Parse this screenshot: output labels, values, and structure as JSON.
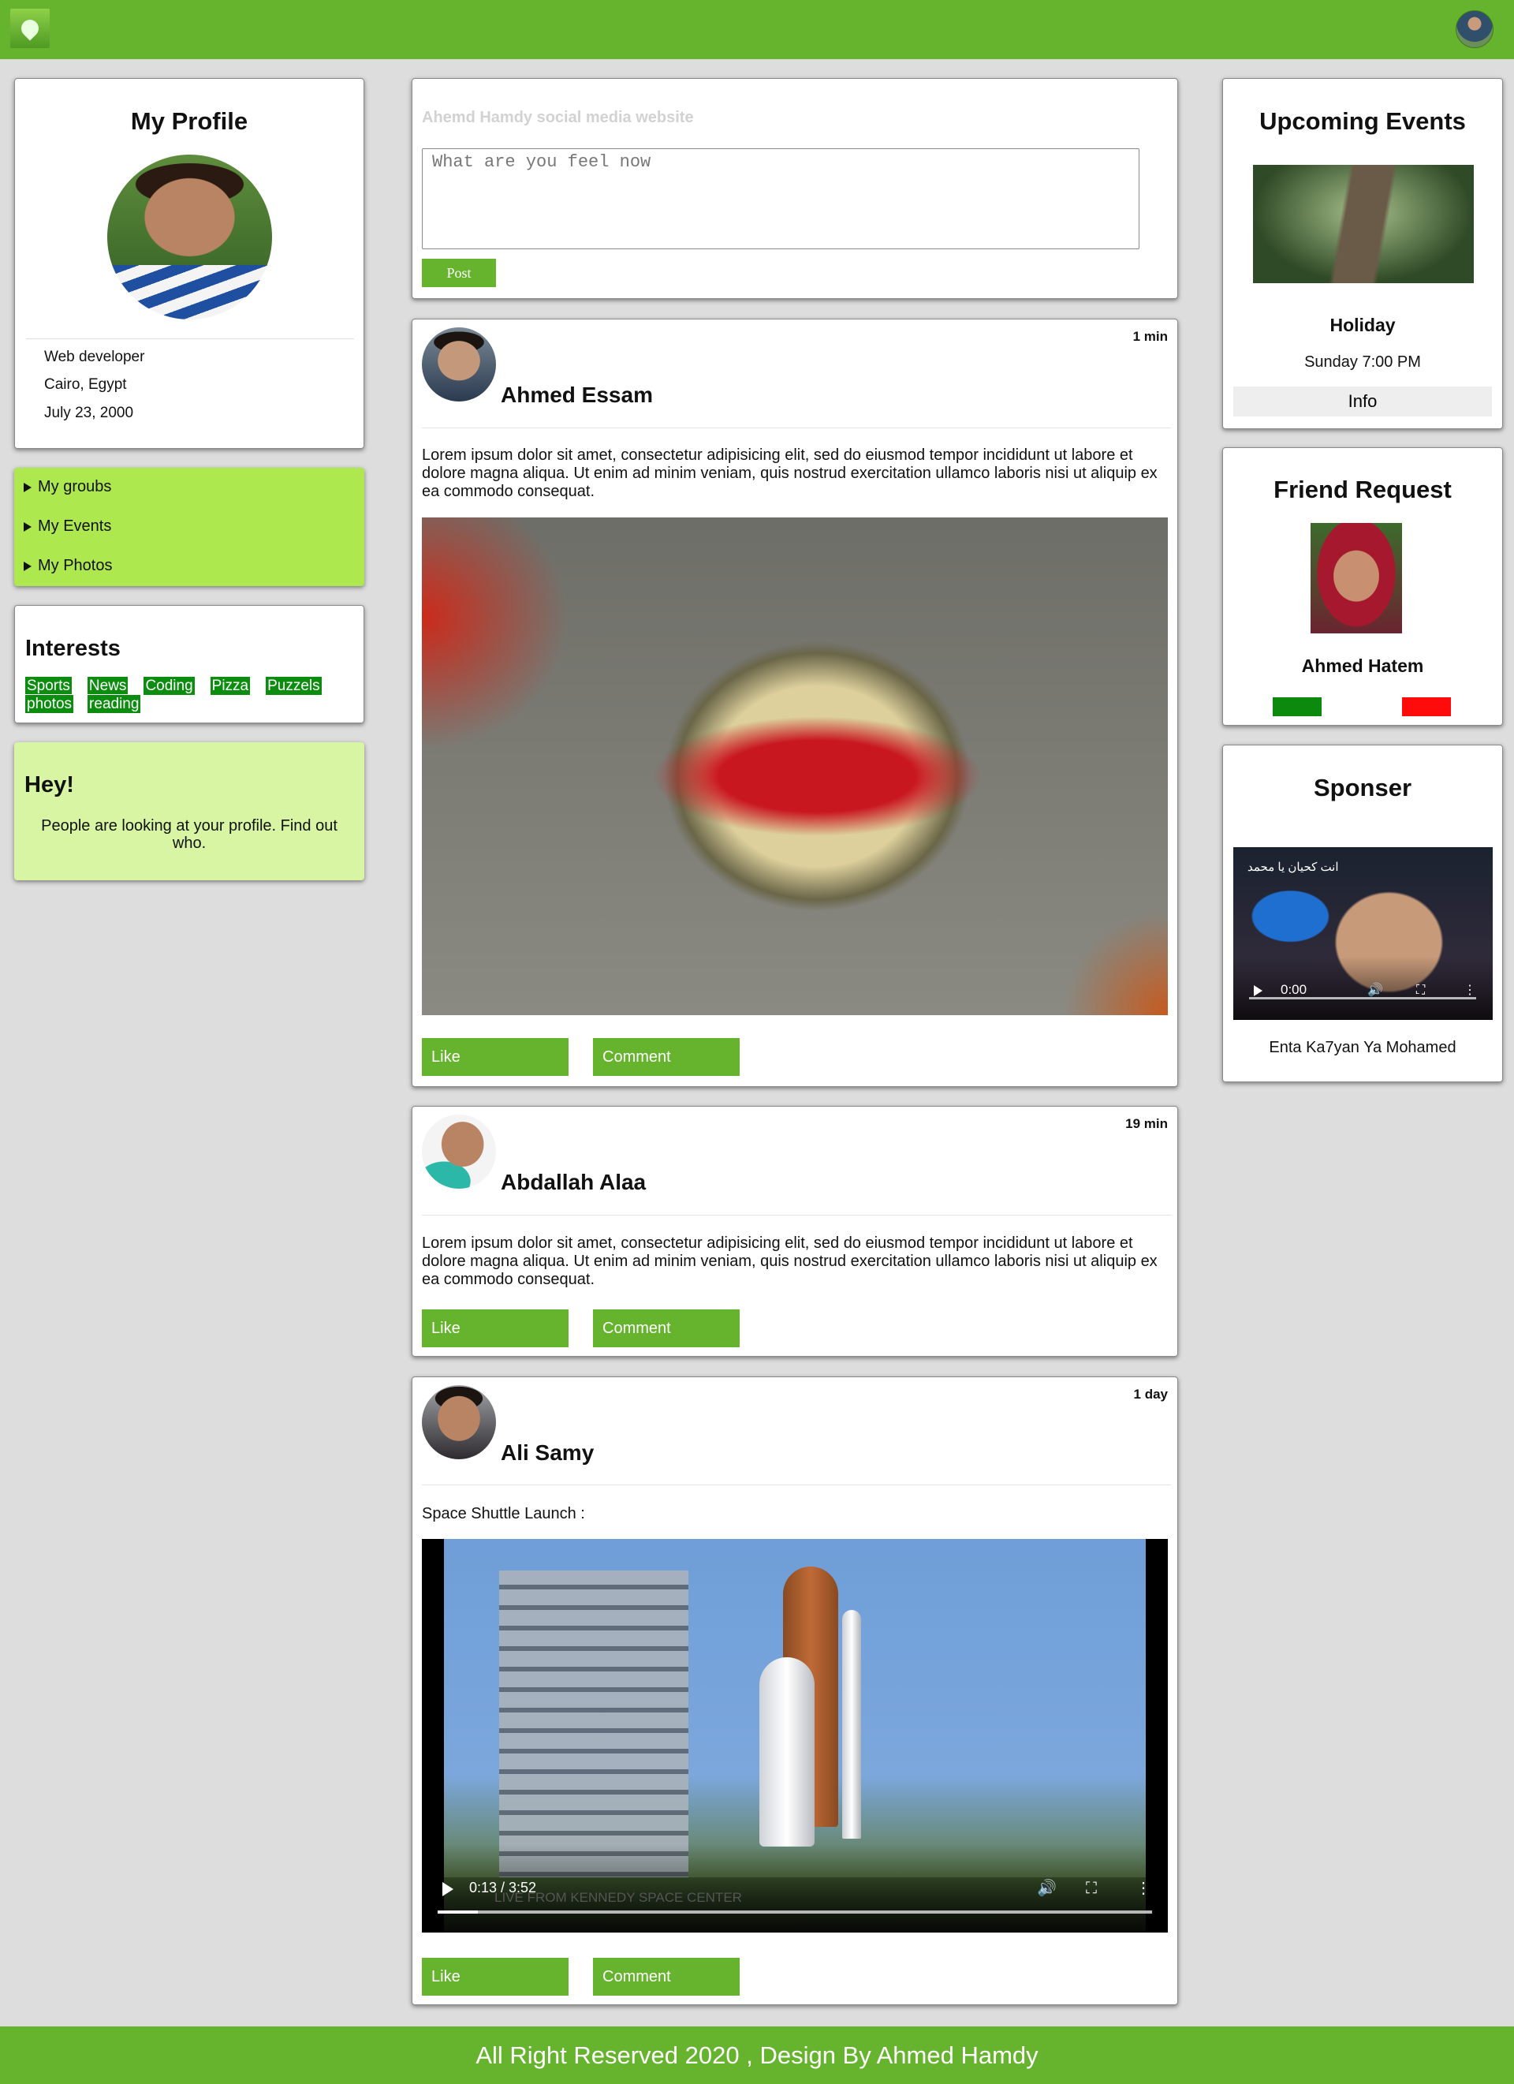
{
  "header": {
    "logo": "site-logo",
    "avatar": "user-avatar"
  },
  "profile": {
    "title": "My Profile",
    "job": "Web developer",
    "location": "Cairo, Egypt",
    "birthday": "July 23, 2000"
  },
  "menu": {
    "items": [
      {
        "label": "My groubs"
      },
      {
        "label": "My Events"
      },
      {
        "label": "My Photos"
      }
    ]
  },
  "interests": {
    "title": "Interests",
    "tags": [
      "Sports",
      "News",
      "Coding",
      "Pizza",
      "Puzzels",
      "photos",
      "reading"
    ]
  },
  "hey": {
    "title": "Hey!",
    "text": "People are looking at your profile. Find out who."
  },
  "composer": {
    "label": "Ahemd Hamdy social media website",
    "placeholder": "What are you feel now",
    "post_label": "Post"
  },
  "posts": [
    {
      "time": "1 min",
      "author": "Ahmed Essam",
      "text": "Lorem ipsum dolor sit amet, consectetur adipisicing elit, sed do eiusmod tempor incididunt ut labore et dolore magna aliqua. Ut enim ad minim veniam, quis nostrud exercitation ullamco laboris nisi ut aliquip ex ea commodo consequat.",
      "like_label": "Like",
      "comment_label": "Comment"
    },
    {
      "time": "19 min",
      "author": "Abdallah Alaa",
      "text": "Lorem ipsum dolor sit amet, consectetur adipisicing elit, sed do eiusmod tempor incididunt ut labore et dolore magna aliqua. Ut enim ad minim veniam, quis nostrud exercitation ullamco laboris nisi ut aliquip ex ea commodo consequat.",
      "like_label": "Like",
      "comment_label": "Comment"
    },
    {
      "time": "1 day",
      "author": "Ali Samy",
      "text": "Space Shuttle Launch :",
      "video": {
        "time": "0:13 / 3:52",
        "caption": "LIVE FROM KENNEDY SPACE CENTER",
        "progress": 0.056
      },
      "like_label": "Like",
      "comment_label": "Comment"
    }
  ],
  "events": {
    "title": "Upcoming Events",
    "name": "Holiday",
    "when": "Sunday 7:00 PM",
    "info_label": "Info"
  },
  "friend_request": {
    "title": "Friend Request",
    "name": "Ahmed Hatem",
    "accept_color": "#0b8a0e",
    "decline_color": "#ff0b0b"
  },
  "sponsor": {
    "title": "Sponser",
    "video_time": "0:00",
    "video_overlay": "انت كحيان يا محمد",
    "caption": "Enta Ka7yan Ya Mohamed"
  },
  "footer": {
    "text": "All Right Reserved 2020 , Design By Ahmed Hamdy"
  },
  "colors": {
    "brand": "#66b32e",
    "menu_bg": "#ace84e",
    "hey_bg": "#d7f5a2",
    "tag": "#0d8d10"
  }
}
